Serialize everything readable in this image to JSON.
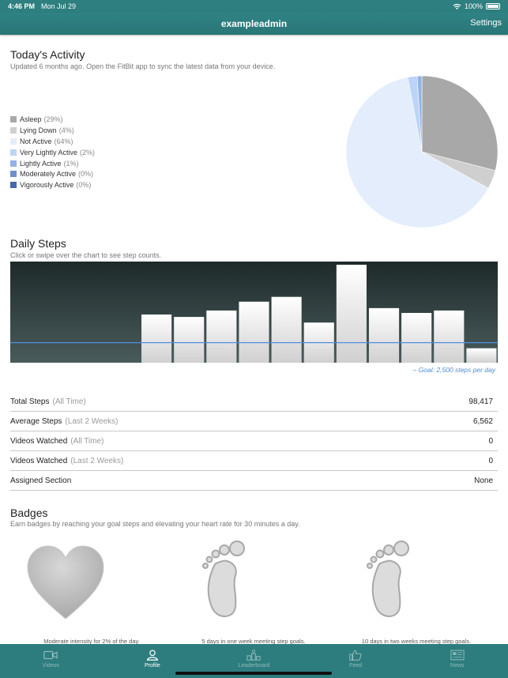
{
  "status": {
    "time": "4:46 PM",
    "date": "Mon Jul 29",
    "battery": "100%"
  },
  "nav": {
    "title": "exampleadmin",
    "settings_label": "Settings"
  },
  "activity": {
    "title": "Today's Activity",
    "subtitle": "Updated 6 months ago. Open the FitBit app to sync the latest data from your device.",
    "legend": [
      {
        "label": "Asleep",
        "pct": "(29%)",
        "value": 29,
        "color": "#a8a8a8"
      },
      {
        "label": "Lying Down",
        "pct": "(4%)",
        "value": 4,
        "color": "#cfcfcf"
      },
      {
        "label": "Not Active",
        "pct": "(64%)",
        "value": 64,
        "color": "#e3edfb"
      },
      {
        "label": "Very Lightly Active",
        "pct": "(2%)",
        "value": 2,
        "color": "#bcd4f8"
      },
      {
        "label": "Lightly Active",
        "pct": "(1%)",
        "value": 1,
        "color": "#93b3e8"
      },
      {
        "label": "Moderately Active",
        "pct": "(0%)",
        "value": 0,
        "color": "#6f8fcf"
      },
      {
        "label": "Vigorously Active",
        "pct": "(0%)",
        "value": 0,
        "color": "#4568ad"
      }
    ]
  },
  "steps": {
    "title": "Daily Steps",
    "subtitle": "Click or swipe over the chart to see step counts.",
    "goal_note": "– Goal: 2,500 steps per day"
  },
  "chart_data": {
    "type": "bar",
    "categories": [
      "",
      "",
      "",
      "",
      "",
      "",
      "",
      "",
      "",
      "",
      "",
      "",
      "",
      "",
      ""
    ],
    "values": [
      0,
      0,
      0,
      0,
      6000,
      5700,
      6500,
      7600,
      8200,
      5000,
      12200,
      6800,
      6200,
      6500,
      1800
    ],
    "goal": 2500,
    "ylim": [
      0,
      12400
    ],
    "title": "",
    "xlabel": "",
    "ylabel": ""
  },
  "stats": [
    {
      "label": "Total Steps",
      "qualifier": "(All Time)",
      "value": "98,417"
    },
    {
      "label": "Average Steps",
      "qualifier": "(Last 2 Weeks)",
      "value": "6,562"
    },
    {
      "label": "Videos Watched",
      "qualifier": "(All Time)",
      "value": "0"
    },
    {
      "label": "Videos Watched",
      "qualifier": "(Last 2 Weeks)",
      "value": "0"
    },
    {
      "label": "Assigned Section",
      "qualifier": "",
      "value": "None"
    }
  ],
  "badges": {
    "title": "Badges",
    "subtitle": "Earn badges by reaching your goal steps and elevating your heart rate for 30 minutes a day.",
    "items": [
      {
        "icon": "heart-icon",
        "caption": "Moderate intensity for 2% of the day."
      },
      {
        "icon": "footprint-icon",
        "caption": "5 days in one week meeting step goals."
      },
      {
        "icon": "footprint-icon",
        "caption": "10 days in two weeks meeting step goals."
      }
    ]
  },
  "tabs": [
    {
      "label": "Videos",
      "icon": "video-camera-icon",
      "active": false
    },
    {
      "label": "Profile",
      "icon": "person-icon",
      "active": true
    },
    {
      "label": "Leaderboard",
      "icon": "leaderboard-icon",
      "active": false
    },
    {
      "label": "Feed",
      "icon": "thumbs-up-icon",
      "active": false
    },
    {
      "label": "News",
      "icon": "newspaper-icon",
      "active": false
    }
  ]
}
